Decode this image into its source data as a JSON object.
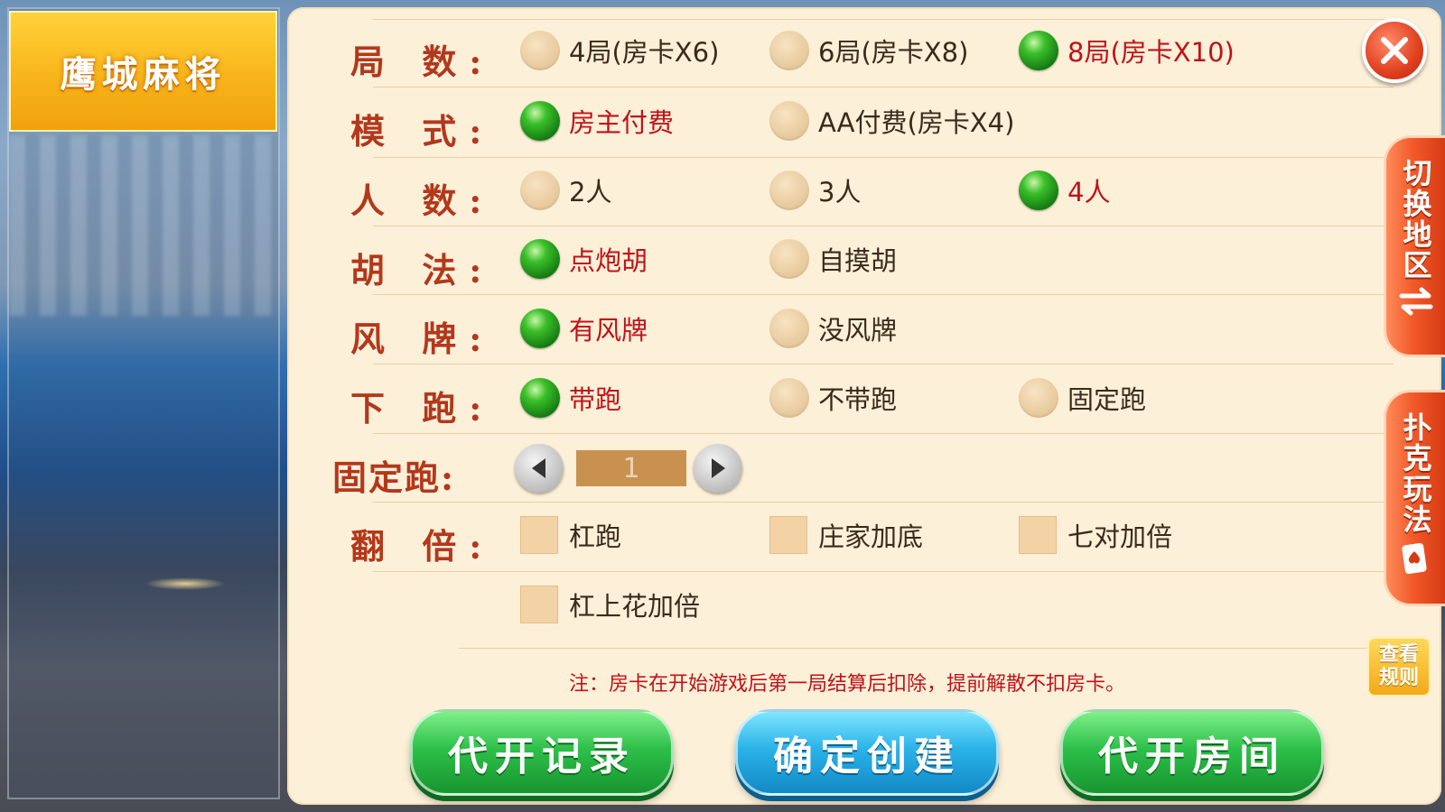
{
  "game_title": "鹰城麻将",
  "rows": [
    {
      "label": "局 数:",
      "options": [
        {
          "text": "4局(房卡X6)",
          "selected": false
        },
        {
          "text": "6局(房卡X8)",
          "selected": false
        },
        {
          "text": "8局(房卡X10)",
          "selected": true
        }
      ]
    },
    {
      "label": "模 式:",
      "options": [
        {
          "text": "房主付费",
          "selected": true
        },
        {
          "text": "AA付费(房卡X4)",
          "selected": false
        }
      ]
    },
    {
      "label": "人 数:",
      "options": [
        {
          "text": "2人",
          "selected": false
        },
        {
          "text": "3人",
          "selected": false
        },
        {
          "text": "4人",
          "selected": true
        }
      ]
    },
    {
      "label": "胡 法:",
      "options": [
        {
          "text": "点炮胡",
          "selected": true
        },
        {
          "text": "自摸胡",
          "selected": false
        }
      ]
    },
    {
      "label": "风 牌:",
      "options": [
        {
          "text": "有风牌",
          "selected": true
        },
        {
          "text": "没风牌",
          "selected": false
        }
      ]
    },
    {
      "label": "下 跑:",
      "options": [
        {
          "text": "带跑",
          "selected": true
        },
        {
          "text": "不带跑",
          "selected": false
        },
        {
          "text": "固定跑",
          "selected": false
        }
      ]
    }
  ],
  "fixed_run": {
    "label": "固定跑:",
    "value": "1"
  },
  "multiplier": {
    "label": "翻 倍:",
    "options": [
      "杠跑",
      "庄家加底",
      "七对加倍",
      "杠上花加倍"
    ]
  },
  "note": "注：房卡在开始游戏后第一局结算后扣除，提前解散不扣房卡。",
  "buttons": {
    "proxy_record": "代开记录",
    "confirm_create": "确定创建",
    "proxy_room": "代开房间"
  },
  "side_tabs": {
    "switch_region": "切换地区",
    "poker_rules": "扑克玩法"
  },
  "rules_button": {
    "line1": "查看",
    "line2": "规则"
  },
  "colors": {
    "panel_bg": "#fdf0d8",
    "label": "#b4381a",
    "selected_text": "#c0121a",
    "radio_on": "#1f9a1c"
  }
}
